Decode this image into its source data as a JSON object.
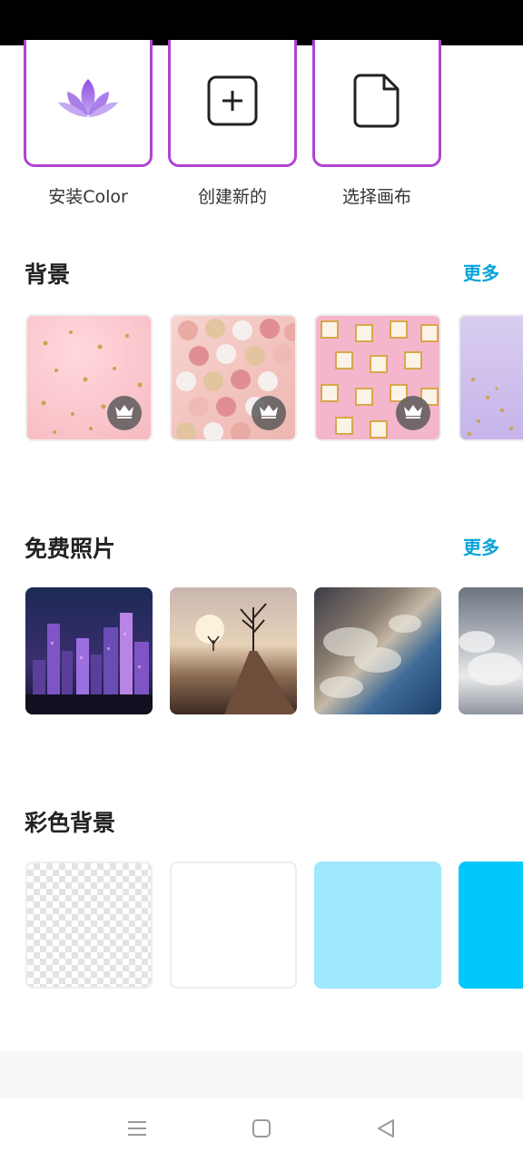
{
  "actions": {
    "install": {
      "label": "安装Color"
    },
    "create": {
      "label": "创建新的"
    },
    "choose": {
      "label": "选择画布"
    }
  },
  "sections": {
    "backgrounds": {
      "title": "背景",
      "more": "更多"
    },
    "photos": {
      "title": "免费照片",
      "more": "更多"
    },
    "colors": {
      "title": "彩色背景"
    }
  },
  "color_swatches": [
    "transparent",
    "#ffffff",
    "#9fe8fd",
    "#00c8fa"
  ],
  "colors": {
    "accent": "#b044d0",
    "link": "#0aa4d9"
  },
  "icons": {
    "install": "lotus-icon",
    "create": "plus-square-icon",
    "choose": "document-icon",
    "premium": "crown-icon",
    "nav": [
      "menu-icon",
      "home-icon",
      "back-icon"
    ]
  }
}
